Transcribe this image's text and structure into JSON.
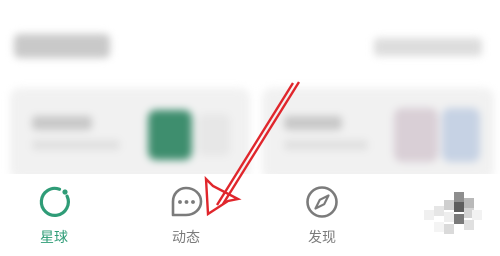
{
  "tabs": [
    {
      "id": "xingqiu",
      "label": "星球",
      "icon": "planet-icon",
      "active": true
    },
    {
      "id": "dongtai",
      "label": "动态",
      "icon": "chat-bubble-icon",
      "active": false
    },
    {
      "id": "faxian",
      "label": "发现",
      "icon": "compass-icon",
      "active": false
    },
    {
      "id": "me",
      "label": "",
      "icon": "profile-icon",
      "active": false
    }
  ],
  "colors": {
    "accent": "#2f9c77",
    "inactive": "#7b7b7b",
    "annotation_arrow": "#e0262c"
  }
}
